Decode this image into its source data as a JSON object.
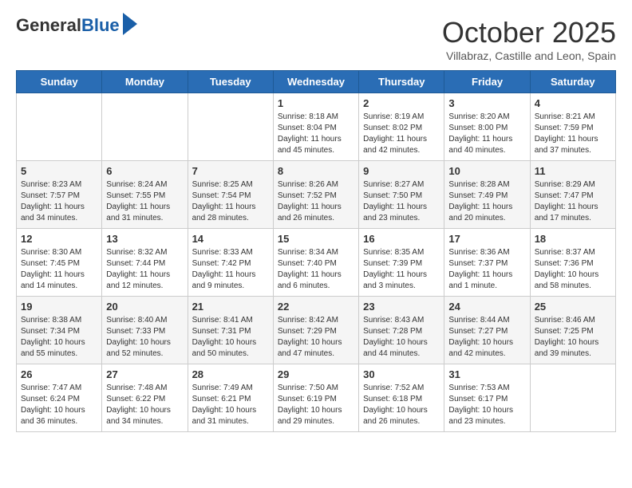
{
  "logo": {
    "line1": "General",
    "line2": "Blue"
  },
  "header": {
    "month": "October 2025",
    "location": "Villabraz, Castille and Leon, Spain"
  },
  "days_of_week": [
    "Sunday",
    "Monday",
    "Tuesday",
    "Wednesday",
    "Thursday",
    "Friday",
    "Saturday"
  ],
  "weeks": [
    [
      {
        "day": "",
        "sunrise": "",
        "sunset": "",
        "daylight": ""
      },
      {
        "day": "",
        "sunrise": "",
        "sunset": "",
        "daylight": ""
      },
      {
        "day": "",
        "sunrise": "",
        "sunset": "",
        "daylight": ""
      },
      {
        "day": "1",
        "sunrise": "Sunrise: 8:18 AM",
        "sunset": "Sunset: 8:04 PM",
        "daylight": "Daylight: 11 hours and 45 minutes."
      },
      {
        "day": "2",
        "sunrise": "Sunrise: 8:19 AM",
        "sunset": "Sunset: 8:02 PM",
        "daylight": "Daylight: 11 hours and 42 minutes."
      },
      {
        "day": "3",
        "sunrise": "Sunrise: 8:20 AM",
        "sunset": "Sunset: 8:00 PM",
        "daylight": "Daylight: 11 hours and 40 minutes."
      },
      {
        "day": "4",
        "sunrise": "Sunrise: 8:21 AM",
        "sunset": "Sunset: 7:59 PM",
        "daylight": "Daylight: 11 hours and 37 minutes."
      }
    ],
    [
      {
        "day": "5",
        "sunrise": "Sunrise: 8:23 AM",
        "sunset": "Sunset: 7:57 PM",
        "daylight": "Daylight: 11 hours and 34 minutes."
      },
      {
        "day": "6",
        "sunrise": "Sunrise: 8:24 AM",
        "sunset": "Sunset: 7:55 PM",
        "daylight": "Daylight: 11 hours and 31 minutes."
      },
      {
        "day": "7",
        "sunrise": "Sunrise: 8:25 AM",
        "sunset": "Sunset: 7:54 PM",
        "daylight": "Daylight: 11 hours and 28 minutes."
      },
      {
        "day": "8",
        "sunrise": "Sunrise: 8:26 AM",
        "sunset": "Sunset: 7:52 PM",
        "daylight": "Daylight: 11 hours and 26 minutes."
      },
      {
        "day": "9",
        "sunrise": "Sunrise: 8:27 AM",
        "sunset": "Sunset: 7:50 PM",
        "daylight": "Daylight: 11 hours and 23 minutes."
      },
      {
        "day": "10",
        "sunrise": "Sunrise: 8:28 AM",
        "sunset": "Sunset: 7:49 PM",
        "daylight": "Daylight: 11 hours and 20 minutes."
      },
      {
        "day": "11",
        "sunrise": "Sunrise: 8:29 AM",
        "sunset": "Sunset: 7:47 PM",
        "daylight": "Daylight: 11 hours and 17 minutes."
      }
    ],
    [
      {
        "day": "12",
        "sunrise": "Sunrise: 8:30 AM",
        "sunset": "Sunset: 7:45 PM",
        "daylight": "Daylight: 11 hours and 14 minutes."
      },
      {
        "day": "13",
        "sunrise": "Sunrise: 8:32 AM",
        "sunset": "Sunset: 7:44 PM",
        "daylight": "Daylight: 11 hours and 12 minutes."
      },
      {
        "day": "14",
        "sunrise": "Sunrise: 8:33 AM",
        "sunset": "Sunset: 7:42 PM",
        "daylight": "Daylight: 11 hours and 9 minutes."
      },
      {
        "day": "15",
        "sunrise": "Sunrise: 8:34 AM",
        "sunset": "Sunset: 7:40 PM",
        "daylight": "Daylight: 11 hours and 6 minutes."
      },
      {
        "day": "16",
        "sunrise": "Sunrise: 8:35 AM",
        "sunset": "Sunset: 7:39 PM",
        "daylight": "Daylight: 11 hours and 3 minutes."
      },
      {
        "day": "17",
        "sunrise": "Sunrise: 8:36 AM",
        "sunset": "Sunset: 7:37 PM",
        "daylight": "Daylight: 11 hours and 1 minute."
      },
      {
        "day": "18",
        "sunrise": "Sunrise: 8:37 AM",
        "sunset": "Sunset: 7:36 PM",
        "daylight": "Daylight: 10 hours and 58 minutes."
      }
    ],
    [
      {
        "day": "19",
        "sunrise": "Sunrise: 8:38 AM",
        "sunset": "Sunset: 7:34 PM",
        "daylight": "Daylight: 10 hours and 55 minutes."
      },
      {
        "day": "20",
        "sunrise": "Sunrise: 8:40 AM",
        "sunset": "Sunset: 7:33 PM",
        "daylight": "Daylight: 10 hours and 52 minutes."
      },
      {
        "day": "21",
        "sunrise": "Sunrise: 8:41 AM",
        "sunset": "Sunset: 7:31 PM",
        "daylight": "Daylight: 10 hours and 50 minutes."
      },
      {
        "day": "22",
        "sunrise": "Sunrise: 8:42 AM",
        "sunset": "Sunset: 7:29 PM",
        "daylight": "Daylight: 10 hours and 47 minutes."
      },
      {
        "day": "23",
        "sunrise": "Sunrise: 8:43 AM",
        "sunset": "Sunset: 7:28 PM",
        "daylight": "Daylight: 10 hours and 44 minutes."
      },
      {
        "day": "24",
        "sunrise": "Sunrise: 8:44 AM",
        "sunset": "Sunset: 7:27 PM",
        "daylight": "Daylight: 10 hours and 42 minutes."
      },
      {
        "day": "25",
        "sunrise": "Sunrise: 8:46 AM",
        "sunset": "Sunset: 7:25 PM",
        "daylight": "Daylight: 10 hours and 39 minutes."
      }
    ],
    [
      {
        "day": "26",
        "sunrise": "Sunrise: 7:47 AM",
        "sunset": "Sunset: 6:24 PM",
        "daylight": "Daylight: 10 hours and 36 minutes."
      },
      {
        "day": "27",
        "sunrise": "Sunrise: 7:48 AM",
        "sunset": "Sunset: 6:22 PM",
        "daylight": "Daylight: 10 hours and 34 minutes."
      },
      {
        "day": "28",
        "sunrise": "Sunrise: 7:49 AM",
        "sunset": "Sunset: 6:21 PM",
        "daylight": "Daylight: 10 hours and 31 minutes."
      },
      {
        "day": "29",
        "sunrise": "Sunrise: 7:50 AM",
        "sunset": "Sunset: 6:19 PM",
        "daylight": "Daylight: 10 hours and 29 minutes."
      },
      {
        "day": "30",
        "sunrise": "Sunrise: 7:52 AM",
        "sunset": "Sunset: 6:18 PM",
        "daylight": "Daylight: 10 hours and 26 minutes."
      },
      {
        "day": "31",
        "sunrise": "Sunrise: 7:53 AM",
        "sunset": "Sunset: 6:17 PM",
        "daylight": "Daylight: 10 hours and 23 minutes."
      },
      {
        "day": "",
        "sunrise": "",
        "sunset": "",
        "daylight": ""
      }
    ]
  ]
}
